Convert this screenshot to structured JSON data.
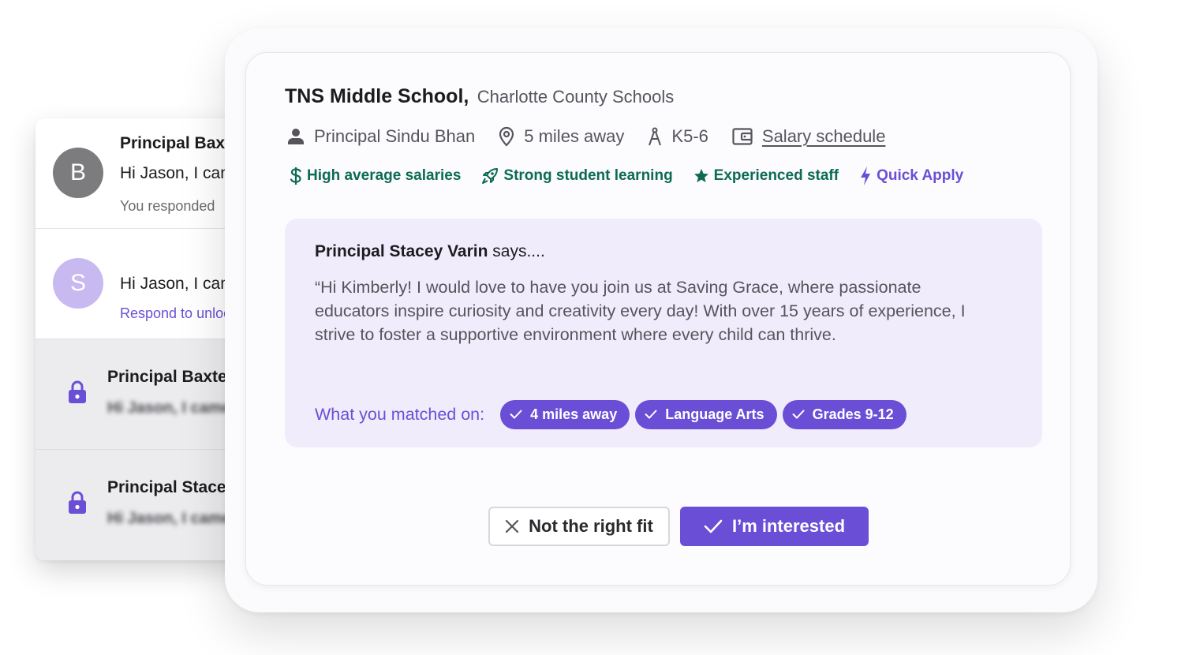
{
  "inbox": {
    "messages": [
      {
        "avatar_letter": "B",
        "name": "Principal Baxter",
        "preview": "Hi Jason, I came across your profile",
        "status": "You responded"
      },
      {
        "avatar_letter": "S",
        "preview": "Hi Jason, I came across your profile",
        "link": "Respond to unlock"
      },
      {
        "name": "Principal Baxter",
        "preview": "Hi Jason, I came across"
      },
      {
        "name": "Principal Stacey",
        "preview": "Hi Jason, I came across"
      }
    ]
  },
  "job": {
    "school_name": "TNS Middle School,",
    "district": "Charlotte County Schools",
    "principal": "Principal Sindu Bhan",
    "distance": "5 miles away",
    "grades": "K5-6",
    "salary_link": "Salary schedule",
    "tags": [
      {
        "label": "High average salaries",
        "icon": "dollar-icon",
        "color": "#0c6b52"
      },
      {
        "label": "Strong student learning",
        "icon": "rocket-icon",
        "color": "#0c6b52"
      },
      {
        "label": "Experienced staff",
        "icon": "star-icon",
        "color": "#0c6b52"
      },
      {
        "label": "Quick Apply",
        "icon": "lightning-icon",
        "color": "#6a4fd6"
      }
    ],
    "message": {
      "speaker": "Principal Stacey Varin",
      "says_suffix": " says....",
      "quote": "“Hi Kimberly! I would love to have you join us at Saving Grace, where passionate educators inspire curiosity and creativity every day! With over 15 years of experience, I strive to foster a supportive environment where every child can thrive.",
      "match_label": "What you matched on:",
      "matches": [
        "4 miles away",
        "Language Arts",
        "Grades 9-12"
      ]
    },
    "actions": {
      "decline_label": "Not the right fit",
      "accept_label": "I’m interested"
    }
  },
  "colors": {
    "accent": "#6a4fd6",
    "positive": "#0c6b52",
    "quote_background": "#f1ecfc"
  }
}
